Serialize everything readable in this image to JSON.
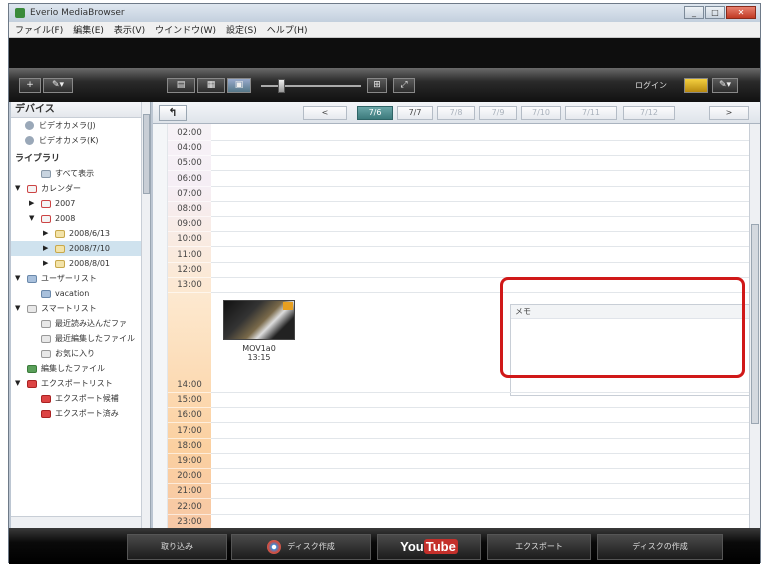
{
  "window": {
    "title": "Everio MediaBrowser",
    "buttons": {
      "minimize": "_",
      "maximize": "□",
      "close": "✕"
    }
  },
  "menu": [
    "ファイル(F)",
    "編集(E)",
    "表示(V)",
    "ウインドウ(W)",
    "設定(S)",
    "ヘルプ(H)"
  ],
  "toolbar": {
    "add_label": "+",
    "tools_label": "✎▾",
    "view_labels": [
      "▤",
      "▦",
      "▣"
    ],
    "zoom_level": 0.2,
    "right_label": "ログイン",
    "icons": [
      "gold-folder-icon",
      "edit-icon"
    ]
  },
  "sidebar": {
    "devices_header": "デバイス",
    "devices": [
      "ビデオカメラ(J)",
      "ビデオカメラ(K)"
    ],
    "library_header": "ライブラリ",
    "items": [
      {
        "label": "すべて表示",
        "indent": 1,
        "arrow": "",
        "icon": "all"
      },
      {
        "label": "カレンダー",
        "indent": 0,
        "arrow": "▼",
        "icon": "cal"
      },
      {
        "label": "2007",
        "indent": 1,
        "arrow": "▶",
        "icon": "cal"
      },
      {
        "label": "2008",
        "indent": 1,
        "arrow": "▼",
        "icon": "cal"
      },
      {
        "label": "2008/6/13",
        "indent": 2,
        "arrow": "▶",
        "icon": "folder"
      },
      {
        "label": "2008/7/10",
        "indent": 2,
        "arrow": "▶",
        "icon": "folder",
        "selected": true
      },
      {
        "label": "2008/8/01",
        "indent": 2,
        "arrow": "▶",
        "icon": "folder"
      },
      {
        "label": "ユーザーリスト",
        "indent": 0,
        "arrow": "▼",
        "icon": "user"
      },
      {
        "label": "vacation",
        "indent": 1,
        "arrow": "",
        "icon": "user"
      },
      {
        "label": "スマートリスト",
        "indent": 0,
        "arrow": "▼",
        "icon": "smart"
      },
      {
        "label": "最近読み込んだファ",
        "indent": 1,
        "arrow": "",
        "icon": "smart"
      },
      {
        "label": "最近編集したファイル",
        "indent": 1,
        "arrow": "",
        "icon": "smart"
      },
      {
        "label": "お気に入り",
        "indent": 1,
        "arrow": "",
        "icon": "smart"
      },
      {
        "label": "編集したファイル",
        "indent": 0,
        "arrow": "",
        "icon": "edit"
      },
      {
        "label": "エクスポートリスト",
        "indent": 0,
        "arrow": "▼",
        "icon": "export"
      },
      {
        "label": "エクスポート候補",
        "indent": 1,
        "arrow": "",
        "icon": "export"
      },
      {
        "label": "エクスポート済み",
        "indent": 1,
        "arrow": "",
        "icon": "export"
      }
    ]
  },
  "navbar": {
    "up_label": "↰",
    "prev_label": "<",
    "next_label": ">",
    "dates": [
      {
        "label": "7/6",
        "state": "active"
      },
      {
        "label": "7/7",
        "state": "normal"
      },
      {
        "label": "7/8",
        "state": "dim"
      },
      {
        "label": "7/9",
        "state": "dim"
      },
      {
        "label": "7/10",
        "state": "dim"
      },
      {
        "label": "7/11",
        "state": "dim"
      },
      {
        "label": "7/12",
        "state": "dim"
      }
    ]
  },
  "timeline": {
    "hours_top": [
      "02:00",
      "04:00",
      "05:00",
      "06:00",
      "07:00",
      "08:00",
      "09:00",
      "10:00",
      "11:00",
      "12:00",
      "13:00"
    ],
    "hours_bottom": [
      "14:00",
      "15:00",
      "16:00",
      "17:00",
      "18:00",
      "19:00",
      "20:00",
      "21:00",
      "22:00",
      "23:00"
    ]
  },
  "media": {
    "name": "MOV1a0",
    "time": "13:15"
  },
  "memo": {
    "header": "メモ"
  },
  "bottom": {
    "buttons": [
      "取り込み",
      "ディスク作成",
      "",
      "エクスポート",
      "ディスクの作成"
    ],
    "youtube_you": "You",
    "youtube_tube": "Tube"
  },
  "colors": {
    "highlight": "#d01818",
    "selected": "#cfe2ee",
    "active_date": "#3c7a7c"
  }
}
